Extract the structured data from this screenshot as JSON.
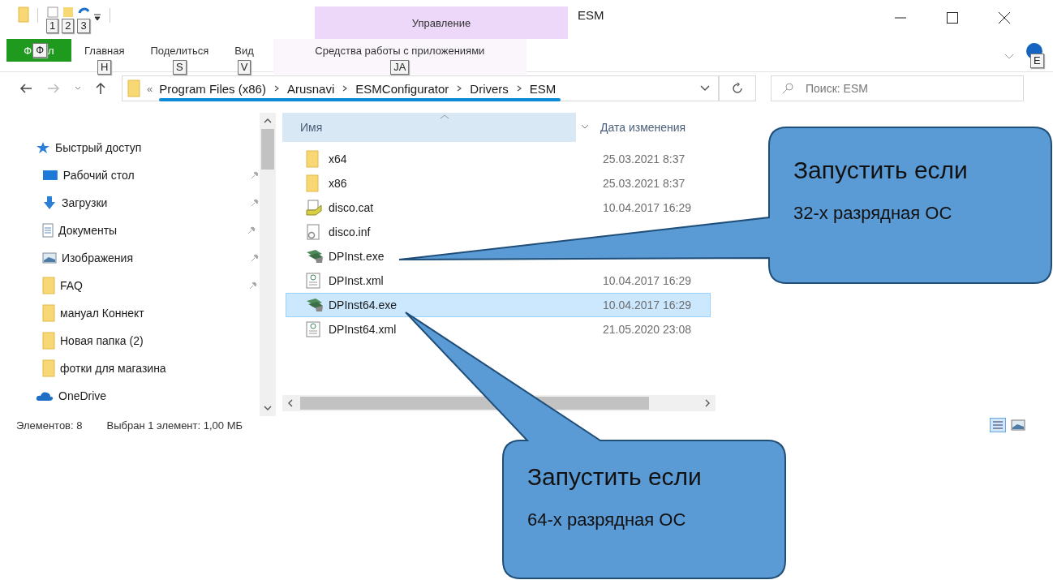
{
  "window": {
    "title": "ESM"
  },
  "quick_access_keytips": [
    "1",
    "2",
    "3"
  ],
  "contextual_group": "Управление",
  "ribbon": {
    "file_tab": {
      "label_start": "Ф",
      "keytip": "Ф",
      "label_end": "л"
    },
    "tabs": [
      {
        "label": "Главная",
        "keytip": "H",
        "kind": "normal"
      },
      {
        "label": "Поделиться",
        "keytip": "S",
        "kind": "normal"
      },
      {
        "label": "Вид",
        "keytip": "V",
        "kind": "normal"
      },
      {
        "label": "Средства работы с приложениями",
        "keytip": "JA",
        "kind": "contextual"
      }
    ],
    "help_keytip": "E"
  },
  "address": {
    "overflow": "«",
    "path": [
      "Program Files (x86)",
      "Arusnavi",
      "ESMConfigurator",
      "Drivers",
      "ESM"
    ]
  },
  "search": {
    "placeholder": "Поиск: ESM"
  },
  "nav": {
    "items": [
      {
        "label": "Быстрый доступ",
        "kind": "star",
        "pinned": false,
        "children": [
          {
            "label": "Рабочий стол",
            "kind": "desktop",
            "pinned": true
          },
          {
            "label": "Загрузки",
            "kind": "download",
            "pinned": true
          },
          {
            "label": "Документы",
            "kind": "document",
            "pinned": true
          },
          {
            "label": "Изображения",
            "kind": "picture",
            "pinned": true
          },
          {
            "label": "FAQ",
            "kind": "folder",
            "pinned": true
          },
          {
            "label": "мануал Коннект",
            "kind": "folder",
            "pinned": false
          },
          {
            "label": "Новая папка (2)",
            "kind": "folder",
            "pinned": false
          },
          {
            "label": "фотки для магазина",
            "kind": "folder",
            "pinned": false
          }
        ]
      },
      {
        "label": "OneDrive",
        "kind": "cloud",
        "pinned": false
      }
    ]
  },
  "files": {
    "columns": [
      "Имя",
      "Дата изменения"
    ],
    "rows": [
      {
        "name": "x64",
        "date": "25.03.2021 8:37",
        "kind": "folder",
        "selected": false
      },
      {
        "name": "x86",
        "date": "25.03.2021 8:37",
        "kind": "folder",
        "selected": false
      },
      {
        "name": "disco.cat",
        "date": "10.04.2017 16:29",
        "kind": "cat",
        "selected": false
      },
      {
        "name": "disco.inf",
        "kind": "inf",
        "selected": false
      },
      {
        "name": "DPInst.exe",
        "kind": "exe",
        "selected": false
      },
      {
        "name": "DPInst.xml",
        "date": "10.04.2017 16:29",
        "kind": "xml",
        "selected": false
      },
      {
        "name": "DPInst64.exe",
        "date": "10.04.2017 16:29",
        "kind": "exe",
        "selected": true
      },
      {
        "name": "DPInst64.xml",
        "date": "21.05.2020 23:08",
        "kind": "xml",
        "selected": false
      }
    ]
  },
  "status": [
    "Элементов: 8",
    "Выбран 1 элемент: 1,00 МБ"
  ],
  "callouts": [
    {
      "title": "Запустить если",
      "text": "32-х разрядная ОС"
    },
    {
      "title": "Запустить если",
      "text": "64-х разрядная ОС"
    }
  ]
}
